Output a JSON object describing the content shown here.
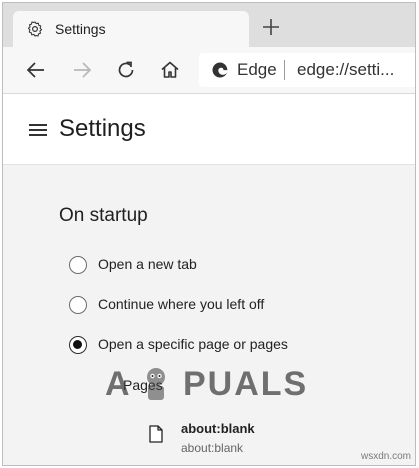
{
  "tab": {
    "title": "Settings",
    "icon": "gear-icon"
  },
  "toolbar": {
    "omnibox_brand": "Edge",
    "omnibox_url": "edge://setti..."
  },
  "header": {
    "title": "Settings"
  },
  "startup": {
    "section_title": "On startup",
    "options": [
      {
        "label": "Open a new tab",
        "checked": false
      },
      {
        "label": "Continue where you left off",
        "checked": false
      },
      {
        "label": "Open a specific page or pages",
        "checked": true
      }
    ],
    "pages_label": "Pages",
    "pages": [
      {
        "title": "about:blank",
        "url": "about:blank"
      }
    ]
  },
  "watermark": {
    "first": "A",
    "rest": "PUALS"
  },
  "credit": "wsxdn.com",
  "colors": {
    "accent": "#0078d4",
    "tabstrip": "#dedede",
    "content_bg": "#f3f3f3"
  }
}
